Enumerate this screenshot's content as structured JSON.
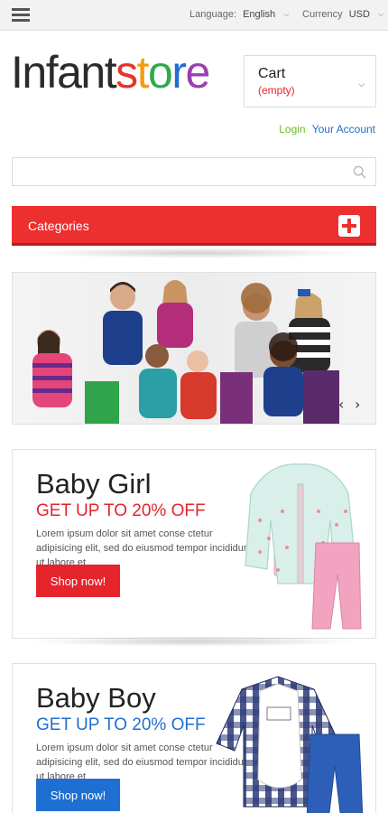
{
  "topbar": {
    "language_label": "Language:",
    "language_value": "English",
    "currency_label": "Currency",
    "currency_value": "USD"
  },
  "logo": {
    "dark_part": "Infant",
    "letters": [
      "s",
      "t",
      "o",
      "r",
      "e"
    ],
    "letter_colors": [
      "#e8332a",
      "#f39c12",
      "#2eaa4a",
      "#1e6fd1",
      "#9b3fb3"
    ]
  },
  "cart": {
    "title": "Cart",
    "status": "(empty)"
  },
  "account": {
    "login": "Login",
    "your_account": "Your Account"
  },
  "search": {
    "placeholder": ""
  },
  "categories": {
    "label": "Categories"
  },
  "colors": {
    "red": "#ec2f2f",
    "blue": "#1e6fd1",
    "green": "#6cbc2c"
  },
  "promos": [
    {
      "title": "Baby Girl",
      "subtitle": "GET UP TO 20% OFF",
      "subtitle_color": "#e5242c",
      "text": "Lorem ipsum dolor sit amet conse ctetur adipisicing elit, sed do eiusmod tempor incididunt ut labore et",
      "button": "Shop now!",
      "button_color": "#e5242c"
    },
    {
      "title": "Baby Boy",
      "subtitle": "GET UP TO 20% OFF",
      "subtitle_color": "#1e6fd1",
      "text": "Lorem ipsum dolor sit amet conse ctetur adipisicing elit, sed do eiusmod tempor incididunt ut labore et",
      "button": "Shop now!",
      "button_color": "#1e6fd1"
    }
  ]
}
